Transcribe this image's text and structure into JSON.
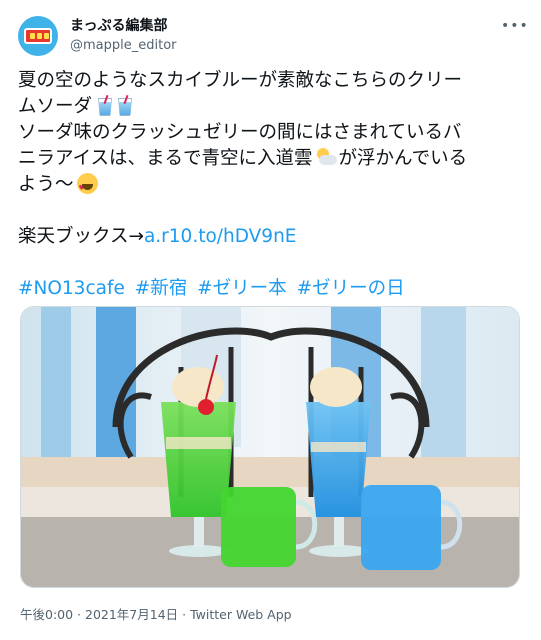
{
  "author": {
    "display_name": "まっぷる編集部",
    "handle": "@mapple_editor",
    "avatar_icon": "mapple-logo-icon",
    "avatar_color": "#3fb3e8"
  },
  "menu_icon": "more-options-icon",
  "tweet": {
    "line1": "夏の空のようなスカイブルーが素敵なこちらのクリー",
    "line2": "ムソーダ",
    "line3": "ソーダ味のクラッシュゼリーの間にはさまれているバ",
    "line4": "ニラアイスは、まるで青空に入道雲",
    "line4b": "が浮かんでいる",
    "line5": "よう〜",
    "store_label": "楽天ブックス→",
    "store_link": "a.r10.to/hDV9nE",
    "hashtags": [
      "#NO13cafe",
      "#新宿",
      "#ゼリー本",
      "#ゼリーの日"
    ]
  },
  "media": {
    "description_icon": "cream-soda-photo"
  },
  "meta": {
    "time": "午後0:00",
    "separator1": " · ",
    "date": "2021年7月14日",
    "separator2": " · ",
    "source": "Twitter Web App"
  },
  "colors": {
    "link": "#1d9bf0",
    "text": "#0f1419",
    "muted": "#536471"
  }
}
